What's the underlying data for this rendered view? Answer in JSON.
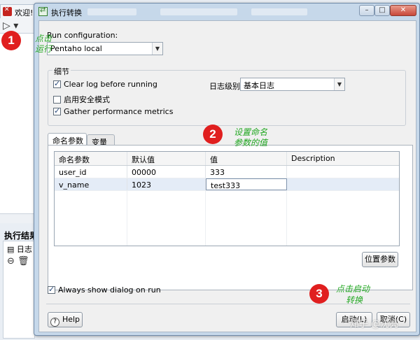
{
  "background": {
    "tab_label": "欢迎!",
    "result_title": "执行结果",
    "log_tab": "日志"
  },
  "dialog": {
    "title": "执行转换",
    "window_buttons": [
      "–",
      "□",
      "✕"
    ],
    "run_configuration_label": "Run configuration:",
    "run_configuration_value": "Pentaho local",
    "details_group_title": "细节",
    "checkboxes": [
      {
        "label": "Clear log before running",
        "checked": true
      },
      {
        "label": "启用安全模式",
        "checked": false
      },
      {
        "label": "Gather performance metrics",
        "checked": true
      }
    ],
    "log_level_label": "日志级别",
    "log_level_value": "基本日志",
    "tabs": [
      {
        "label": "命名参数",
        "active": true
      },
      {
        "label": "变量",
        "active": false
      }
    ],
    "table": {
      "headers": [
        "命名参数",
        "默认值",
        "值",
        "Description"
      ],
      "rows": [
        [
          "user_id",
          "00000",
          "333",
          ""
        ],
        [
          "v_name",
          "1023",
          "test333",
          ""
        ]
      ]
    },
    "position_params_button": "位置参数",
    "always_show_label": "Always show dialog on run",
    "always_show_checked": true,
    "help_button": "Help",
    "launch_button": "启动(L)",
    "cancel_button": "取消(C)"
  },
  "annotations": {
    "step1_number": "1",
    "step1_text": "点击运行",
    "step2_number": "2",
    "step2_text_line1": "设置命名",
    "step2_text_line2": "参数的值",
    "step3_number": "3",
    "step3_text_line1": "点击启动",
    "step3_text_line2": "转换"
  },
  "watermark": "知乎 @沈亮",
  "colors": {
    "badge": "#e01f1f",
    "annotation_text": "#23a823",
    "dialog_frame": "#c6d8ea"
  }
}
